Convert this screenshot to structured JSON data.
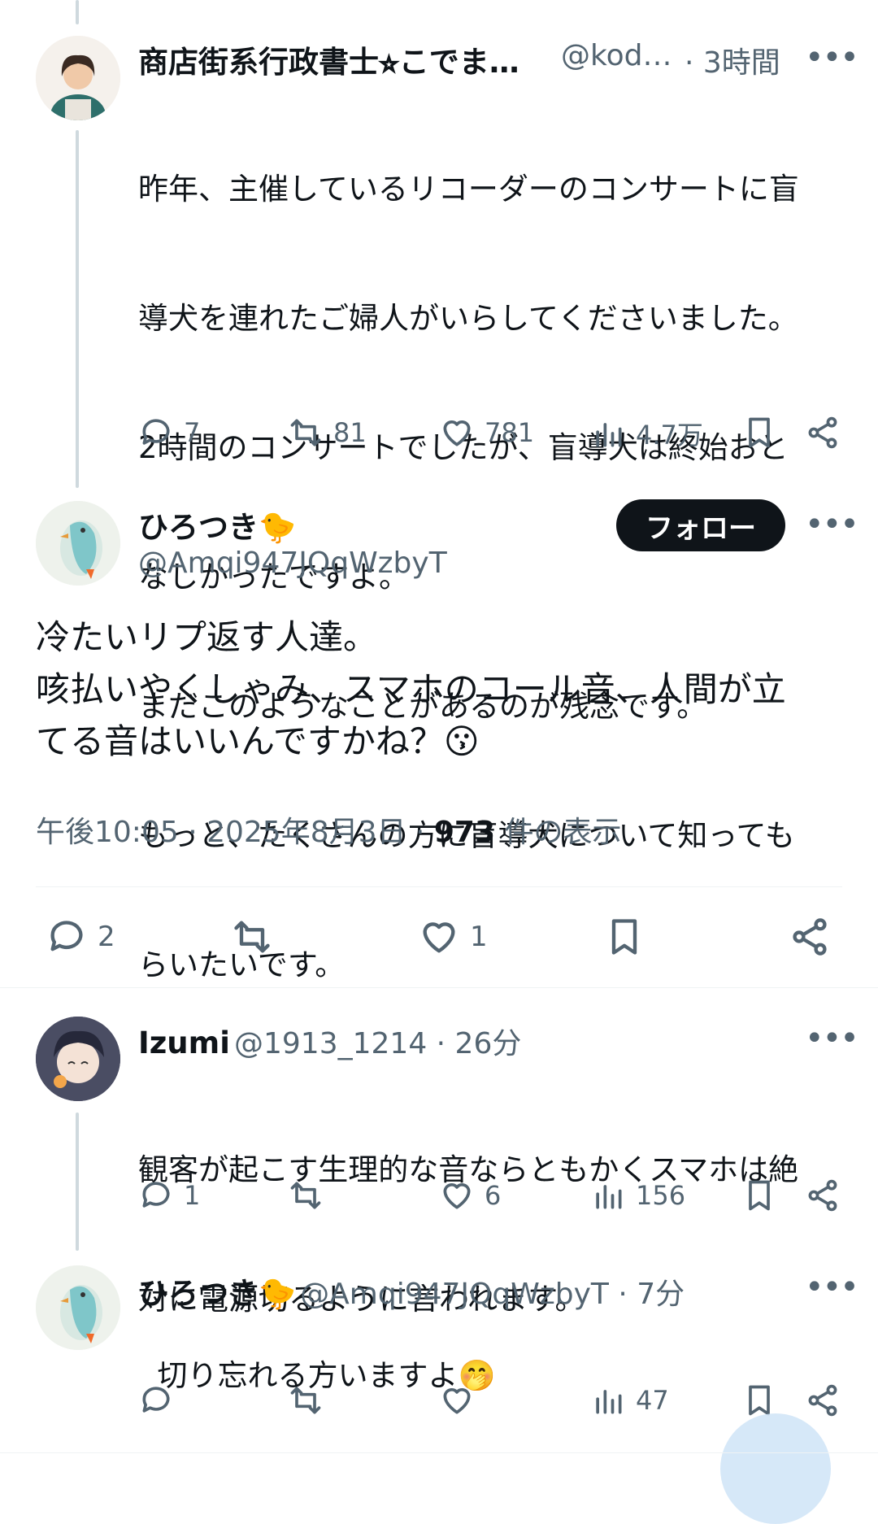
{
  "colors": {
    "text": "#0f1419",
    "muted": "#536471",
    "follow_bg": "#0f1419",
    "follow_text": "#ffffff",
    "line": "#cfd9de"
  },
  "post1": {
    "name": "商店街系行政書士⭐︎こでま…",
    "handle": "@kod…",
    "time": "· 3時間",
    "lines": [
      "昨年、主催しているリコーダーのコンサートに盲",
      "導犬を連れたご婦人がいらしてくださいました。",
      "2時間のコンサートでしたが、盲導犬は終始おと",
      "なしかったですよ。",
      "まだこのようなことがあるのが残念です。",
      "もっと、たくさんの方に盲導犬について知っても",
      "らいたいです。"
    ],
    "replies": "7",
    "reposts": "81",
    "likes": "781",
    "views": "4.7万"
  },
  "main": {
    "name": "ひろつき",
    "name_emoji": "🐤",
    "handle": "@Amqi947JQqWzbyT",
    "follow_label": "フォロー",
    "lines": [
      "冷たいリプ返す人達。",
      "咳払いやくしゃみ、スマホのコール音、人間が立",
      "てる音はいいんですかね？"
    ],
    "emoji": "😗",
    "time": "午後10:05 · 2025年8月3日 · ",
    "views_count": "973",
    "views_label": " 件の表示",
    "replies": "2",
    "likes": "1"
  },
  "reply1": {
    "name": "Izumi",
    "handle": "@1913_1214 · 26分",
    "lines": [
      "観客が起こす生理的な音ならともかくスマホは絶",
      "対に電源切るように言われます。"
    ],
    "replies": "1",
    "likes": "6",
    "views": "156"
  },
  "reply2": {
    "name": "ひろつき",
    "name_emoji": "🐤",
    "handle": "@Amqi947JQqWzbyT · 7分",
    "text": "切り忘れる方いますよ",
    "emoji": "🤭",
    "views": "47"
  },
  "more_glyph": "•••"
}
